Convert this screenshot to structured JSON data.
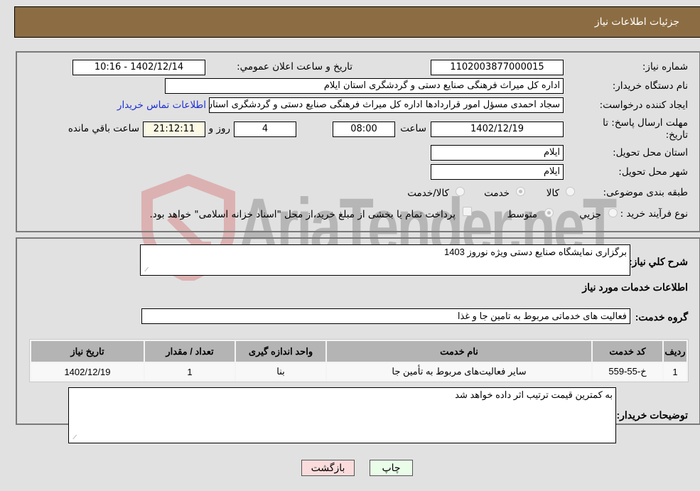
{
  "header": {
    "title": "جزئیات اطلاعات نیاز"
  },
  "details": {
    "need_number_label": "شماره نیاز:",
    "need_number": "1102003877000015",
    "announce_label": "تاریخ و ساعت اعلان عمومي:",
    "announce_value": "1402/12/14 - 10:16",
    "buyer_org_label": "نام دستگاه خریدار:",
    "buyer_org": "اداره کل میراث فرهنگی  صنایع دستی و گردشگری استان ایلام",
    "creator_label": "ایجاد کننده درخواست:",
    "creator": "سجاد احمدی مسؤل امور قراردادها اداره کل میراث فرهنگی  صنایع دستی و گردشگری استان ایلام",
    "contact_link": "اطلاعات تماس خریدار",
    "deadline_label": "مهلت ارسال پاسخ: تا تاریخ:",
    "deadline_date": "1402/12/19",
    "time_label": "ساعت",
    "deadline_time": "08:00",
    "days_value": "4",
    "days_label": "روز و",
    "remaining_time": "21:12:11",
    "remaining_label": "ساعت باقي مانده",
    "province_label": "استان محل تحویل:",
    "province": "ایلام",
    "city_label": "شهر محل تحویل:",
    "city": "ایلام",
    "category_label": "طبقه بندی موضوعی:",
    "category_options": [
      {
        "label": "کالا",
        "checked": false
      },
      {
        "label": "خدمت",
        "checked": true
      },
      {
        "label": "کالا/خدمت",
        "checked": false
      }
    ],
    "process_label": "نوع فرآیند خرید :",
    "process_options": [
      {
        "label": "جزيي",
        "checked": false
      },
      {
        "label": "متوسط",
        "checked": true
      }
    ],
    "treasury_checkbox_label": "پرداخت تمام یا بخشی از مبلغ خرید،از محل \"اسناد خزانه اسلامی\" خواهد بود."
  },
  "services": {
    "description_label": "شرح کلي نیاز:",
    "description": "برگزاری نمایشگاه صنایع دستی ویژه نوروز 1403",
    "section_title": "اطلاعات خدمات مورد نیاز",
    "group_label": "گروه خدمت:",
    "group_value": "فعالیت های خدماتی مربوط به تامین جا و غذا",
    "table": {
      "headers": [
        "ردیف",
        "کد خدمت",
        "نام خدمت",
        "واحد اندازه گیری",
        "تعداد / مقدار",
        "تاریخ نیاز"
      ],
      "rows": [
        [
          "1",
          "خ-55-559",
          "سایر فعالیت‌های مربوط به تأمین جا",
          "بنا",
          "1",
          "1402/12/19"
        ]
      ]
    },
    "buyer_notes_label": "توضیحات خریدار:",
    "buyer_notes": "به کمترین قیمت ترتیب اثر داده خواهد شد"
  },
  "buttons": {
    "print": "چاپ",
    "back": "بازگشت"
  },
  "watermark": {
    "text": "AriaTender.neT"
  },
  "colors": {
    "header_bg": "#8c6d43",
    "link": "#1f2fd6",
    "back_btn": "#fbdcdc",
    "print_btn": "#e9fde9"
  }
}
